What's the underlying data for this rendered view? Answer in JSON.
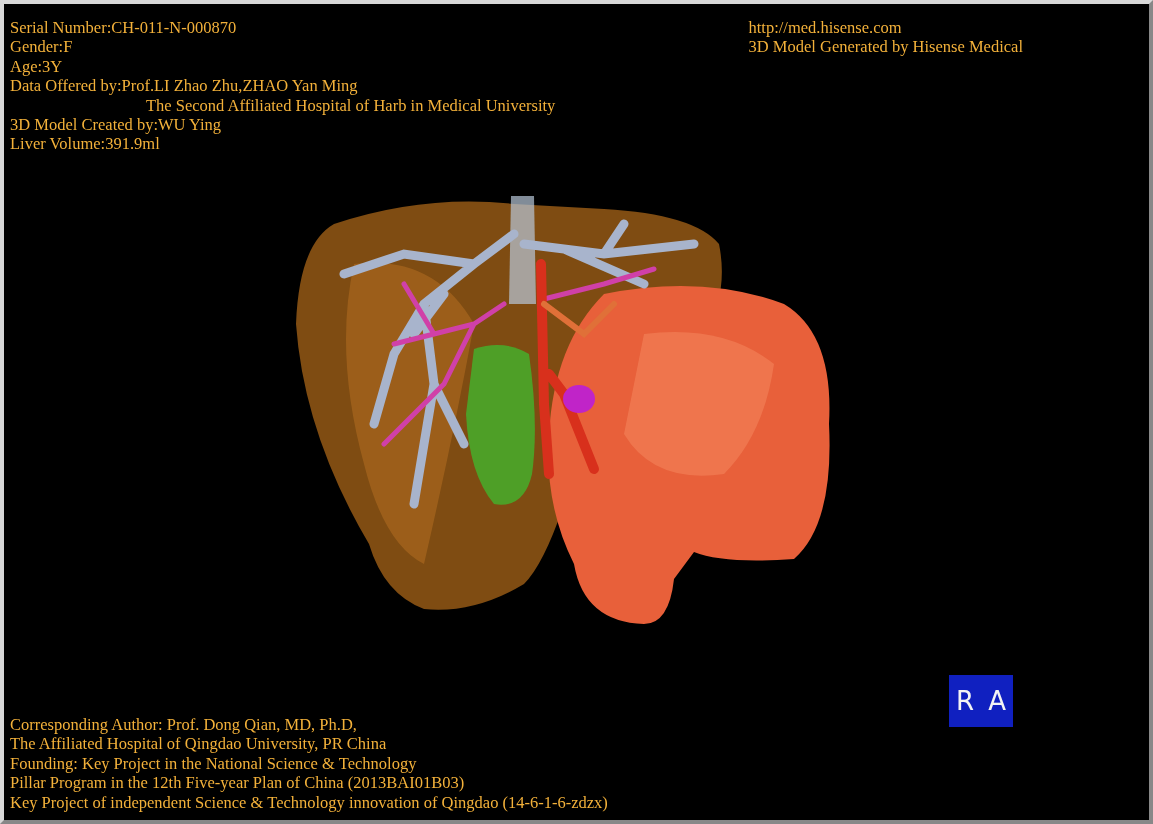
{
  "patient_info": [
    {
      "kind": "plain",
      "text": "Serial Number:CH-011-N-000870"
    },
    {
      "kind": "plain",
      "text": "Gender:F"
    },
    {
      "kind": "plain",
      "text": "Age:3Y"
    },
    {
      "kind": "plain",
      "text": "Data Offered by:Prof.LI Zhao Zhu,ZHAO Yan Ming"
    },
    {
      "kind": "indented",
      "text": "The Second Affiliated Hospital of Harb in Medical University"
    },
    {
      "kind": "plain",
      "text": "3D Model Created by:WU Ying"
    },
    {
      "kind": "plain",
      "text": "Liver Volume:391.9ml"
    }
  ],
  "vendor_info": [
    "http://med.hisense.com",
    "3D Model Generated by Hisense Medical"
  ],
  "credits": [
    "Corresponding Author: Prof. Dong Qian, MD, Ph.D,",
    "The Affiliated Hospital of Qingdao University, PR China",
    "Founding: Key Project in the National Science & Technology",
    "Pillar Program in the 12th Five-year Plan of China (2013BAI01B03)",
    "Key Project of independent Science & Technology innovation of Qingdao (14-6-1-6-zdzx)"
  ],
  "orientation_cube": [
    "R",
    "A"
  ]
}
